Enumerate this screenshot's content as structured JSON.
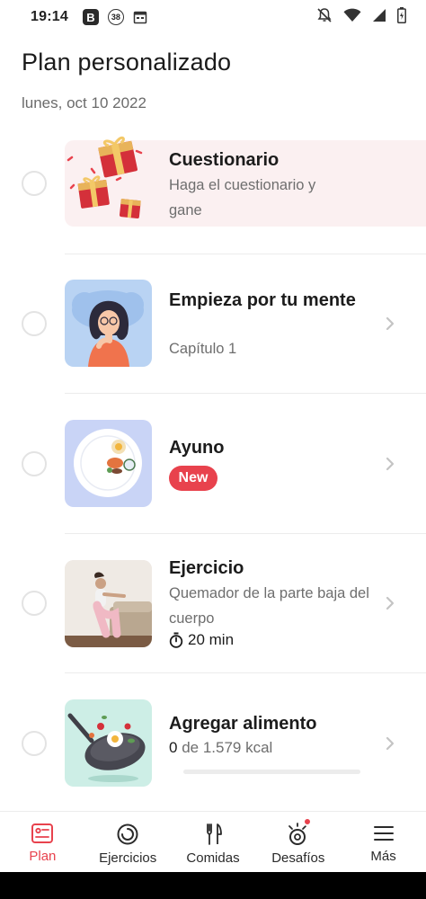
{
  "status_bar": {
    "time": "19:14",
    "notification_b": "B",
    "notification_count": "38"
  },
  "header": {
    "title": "Plan personalizado",
    "date": "lunes, oct 10 2022"
  },
  "tasks": [
    {
      "title": "Cuestionario",
      "subtitle": "Haga el cuestionario y gane"
    },
    {
      "title": "Empieza por tu mente",
      "subtitle": "Capítulo 1"
    },
    {
      "title": "Ayuno",
      "badge": "New"
    },
    {
      "title": "Ejercicio",
      "subtitle": "Quemador de la parte baja del cuerpo",
      "duration": "20 min"
    },
    {
      "title": "Agregar alimento",
      "kcal_current": "0",
      "kcal_rest": "de 1.579 kcal",
      "progress": 0
    }
  ],
  "tabs": [
    {
      "label": "Plan",
      "icon": "plan-icon",
      "active": true
    },
    {
      "label": "Ejercicios",
      "icon": "exercise-ring-icon"
    },
    {
      "label": "Comidas",
      "icon": "fork-knife-icon"
    },
    {
      "label": "Desafíos",
      "icon": "challenge-icon",
      "notification_dot": true
    },
    {
      "label": "Más",
      "icon": "menu-icon"
    }
  ],
  "colors": {
    "accent": "#e8424d",
    "quiz_background": "#fbf0f1",
    "mind_background": "#b9d3f3",
    "fasting_background": "#c9d4f6",
    "food_background": "#cdeee6"
  }
}
